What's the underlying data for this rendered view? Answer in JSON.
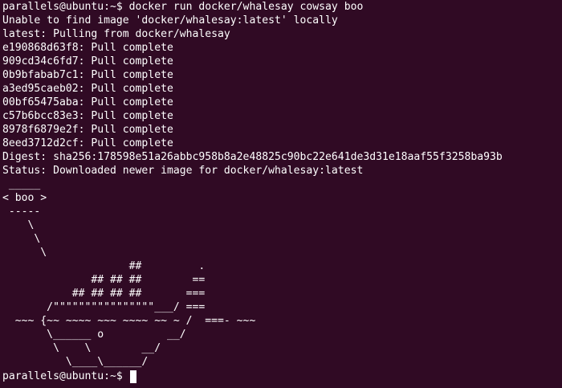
{
  "terminal": {
    "lines": [
      "parallels@ubuntu:~$ docker run docker/whalesay cowsay boo",
      "Unable to find image 'docker/whalesay:latest' locally",
      "latest: Pulling from docker/whalesay",
      "e190868d63f8: Pull complete",
      "909cd34c6fd7: Pull complete",
      "0b9bfabab7c1: Pull complete",
      "a3ed95caeb02: Pull complete",
      "00bf65475aba: Pull complete",
      "c57b6bcc83e3: Pull complete",
      "8978f6879e2f: Pull complete",
      "8eed3712d2cf: Pull complete",
      "Digest: sha256:178598e51a26abbc958b8a2e48825c90bc22e641de3d31e18aaf55f3258ba93b",
      "Status: Downloaded newer image for docker/whalesay:latest",
      " _____",
      "< boo >",
      " -----",
      "    \\",
      "     \\",
      "      \\",
      "                    ##         .",
      "              ## ## ##        ==",
      "           ## ## ## ##       ===",
      "       /\"\"\"\"\"\"\"\"\"\"\"\"\"\"\"\"___/ ===",
      "  ~~~ {~~ ~~~~ ~~~ ~~~~ ~~ ~ /  ===- ~~~",
      "       \\______ o          __/",
      "        \\    \\        __/",
      "          \\____\\______/"
    ],
    "prompt": "parallels@ubuntu:~$ ",
    "colors": {
      "background": "#300a24",
      "foreground": "#ffffff"
    }
  }
}
